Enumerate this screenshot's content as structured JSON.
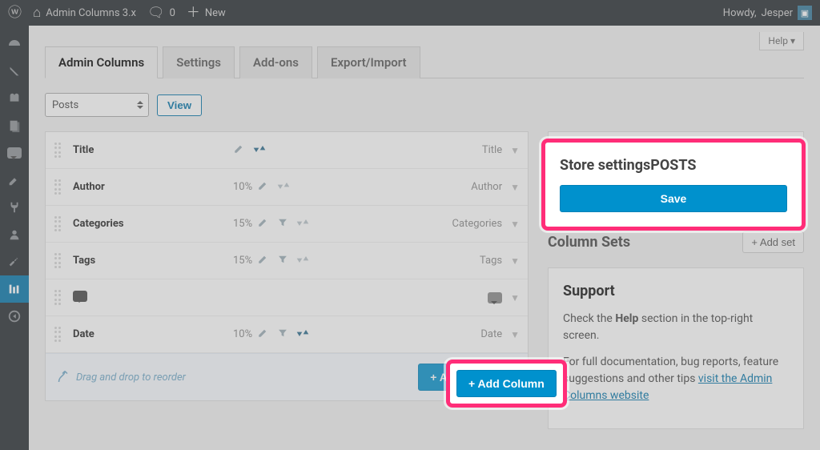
{
  "toolbar": {
    "site_title": "Admin Columns 3.x",
    "comments_count": "0",
    "new_label": "New",
    "howdy_prefix": "Howdy, ",
    "username": "Jesper"
  },
  "help_tab": "Help",
  "tabs": [
    {
      "label": "Admin Columns",
      "active": true
    },
    {
      "label": "Settings",
      "active": false
    },
    {
      "label": "Add-ons",
      "active": false
    },
    {
      "label": "Export/Import",
      "active": false
    }
  ],
  "list_select": {
    "value": "Posts"
  },
  "view_btn": "View",
  "columns": [
    {
      "label": "Title",
      "width": "",
      "has_pencil": true,
      "has_filter": false,
      "sort": "active",
      "type_label": "Title",
      "is_icon": false
    },
    {
      "label": "Author",
      "width": "10%",
      "has_pencil": true,
      "has_filter": false,
      "sort": "muted",
      "type_label": "Author",
      "is_icon": false
    },
    {
      "label": "Categories",
      "width": "15%",
      "has_pencil": true,
      "has_filter": true,
      "sort": "muted",
      "type_label": "Categories",
      "is_icon": false
    },
    {
      "label": "Tags",
      "width": "15%",
      "has_pencil": true,
      "has_filter": true,
      "sort": "muted",
      "type_label": "Tags",
      "is_icon": false
    },
    {
      "label": "",
      "width": "",
      "has_pencil": false,
      "has_filter": false,
      "sort": "none",
      "type_label": "",
      "is_icon": true
    },
    {
      "label": "Date",
      "width": "10%",
      "has_pencil": true,
      "has_filter": true,
      "sort": "active",
      "type_label": "Date",
      "is_icon": false
    }
  ],
  "reorder_hint": "Drag and drop to reorder",
  "add_column_btn": "+ Add Column",
  "side": {
    "store": {
      "heading": "Store settings",
      "context": "POSTS",
      "save_btn": "Save"
    },
    "sets": {
      "heading": "Column Sets",
      "add_btn": "+ Add set"
    },
    "support": {
      "heading": "Support",
      "line1_a": "Check the ",
      "line1_b": "Help",
      "line1_c": " section in the top-right screen.",
      "line2": "For full documentation, bug reports, feature suggestions and other tips ",
      "link": "visit the Admin Columns website"
    }
  }
}
